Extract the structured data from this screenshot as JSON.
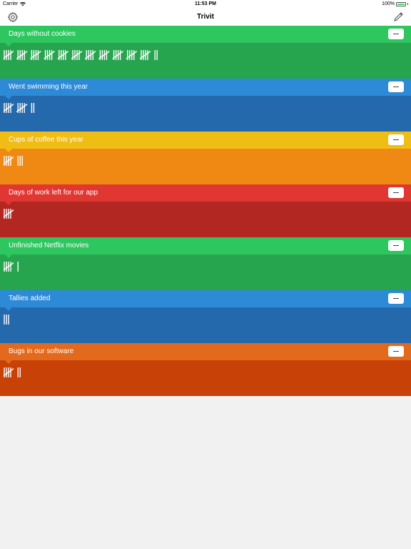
{
  "status": {
    "carrier": "Carrier",
    "time": "11:53 PM",
    "battery": "100%",
    "battery_level": 1.0
  },
  "nav": {
    "title": "Trivit",
    "settings_icon": "gear-icon",
    "edit_icon": "pencil-icon"
  },
  "counters": [
    {
      "label": "Days without cookies",
      "count": 57,
      "head_color": "#2dc65f",
      "body_color": "#27a44e"
    },
    {
      "label": "Went swimming this year",
      "count": 12,
      "head_color": "#2d8ad6",
      "body_color": "#2469ab"
    },
    {
      "label": "Cups of coffee this year",
      "count": 8,
      "head_color": "#f0bd15",
      "body_color": "#ef8914"
    },
    {
      "label": "Days of work left for our app",
      "count": 5,
      "head_color": "#e13732",
      "body_color": "#b32722"
    },
    {
      "label": "Unfinished Netflix movies",
      "count": 6,
      "head_color": "#2dc65f",
      "body_color": "#27a44e"
    },
    {
      "label": "Tallies added",
      "count": 3,
      "head_color": "#2d8ad6",
      "body_color": "#2469ab"
    },
    {
      "label": "Bugs in our software",
      "count": 7,
      "head_color": "#e3691d",
      "body_color": "#c84106"
    }
  ]
}
